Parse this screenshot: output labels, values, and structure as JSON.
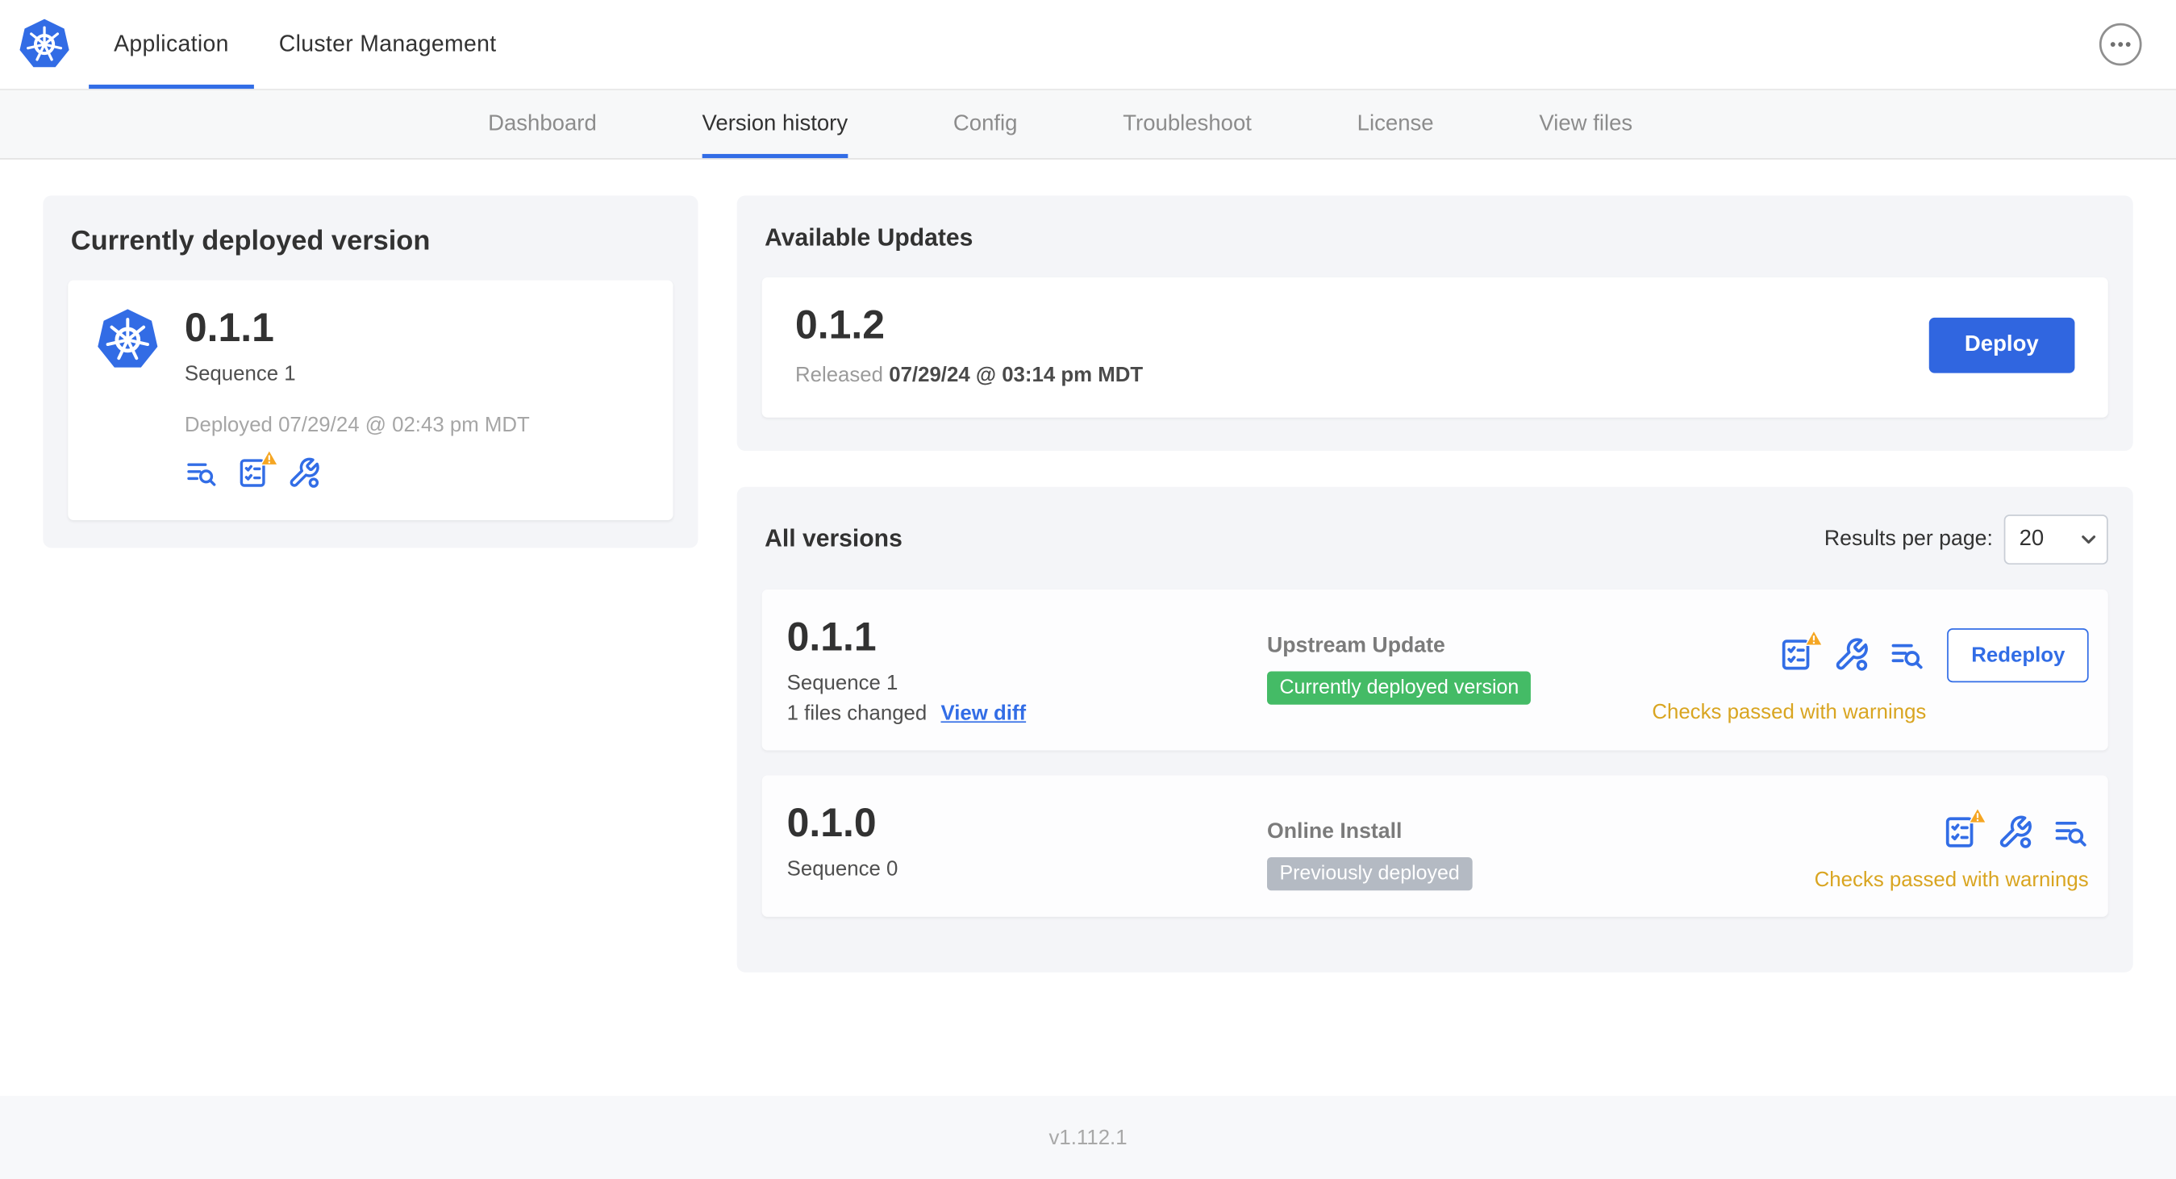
{
  "colors": {
    "primary_blue": "#326de6",
    "deploy_button_blue": "#3066e0",
    "badge_green": "#44bb66",
    "badge_gray": "#b4bac3",
    "warning_orange": "#d9a521",
    "k8s_logo_blue": "#326ce5"
  },
  "topbar": {
    "tabs": [
      {
        "label": "Application",
        "active": true
      },
      {
        "label": "Cluster Management",
        "active": false
      }
    ],
    "icons": {
      "logo": "kubernetes-logo",
      "menu": "ellipsis-menu-icon"
    }
  },
  "subnav": {
    "tabs": [
      "Dashboard",
      "Version history",
      "Config",
      "Troubleshoot",
      "License",
      "View files"
    ],
    "active_tab": "Version history"
  },
  "current_version": {
    "title": "Currently deployed version",
    "version": "0.1.1",
    "sequence": "Sequence 1",
    "deployed": "Deployed 07/29/24 @ 02:43 pm MDT",
    "icons": [
      "diff-icon",
      "preflight-checks-warning-icon",
      "config-wrench-icon"
    ]
  },
  "available_updates": {
    "title": "Available Updates",
    "version": "0.1.2",
    "released_prefix": "Released",
    "released_date": "07/29/24 @ 03:14 pm MDT",
    "deploy_label": "Deploy"
  },
  "all_versions": {
    "title": "All versions",
    "results_per_page_label": "Results per page:",
    "results_per_page_value": "20",
    "rows": [
      {
        "version": "0.1.1",
        "sequence": "Sequence 1",
        "files_changed": "1 files changed",
        "view_diff_label": "View diff",
        "source": "Upstream Update",
        "badge": "Currently deployed version",
        "badge_style": "green",
        "action_label": "Redeploy",
        "status": "Checks passed with warnings",
        "icons": [
          "preflight-checks-warning-icon",
          "config-wrench-icon",
          "diff-icon"
        ]
      },
      {
        "version": "0.1.0",
        "sequence": "Sequence 0",
        "source": "Online Install",
        "badge": "Previously deployed",
        "badge_style": "gray",
        "status": "Checks passed with warnings",
        "icons": [
          "preflight-checks-warning-icon",
          "config-wrench-icon",
          "diff-icon"
        ]
      }
    ]
  },
  "footer": {
    "version": "v1.112.1"
  }
}
